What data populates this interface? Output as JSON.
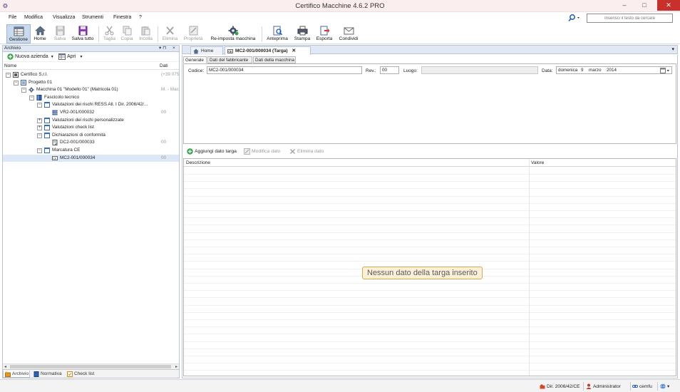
{
  "window": {
    "title": "Certifico Macchine 4.6.2 PRO",
    "minimize": "–",
    "maximize": "□",
    "close": "✕"
  },
  "menu": {
    "items": [
      "File",
      "Modifica",
      "Visualizza",
      "Strumenti",
      "Finestra",
      "?"
    ],
    "search_placeholder": "Inserisci il testo da cercare"
  },
  "toolbar": {
    "buttons": [
      {
        "label": "Gestione",
        "icon": "grid-table-icon",
        "state": "active"
      },
      {
        "label": "Home",
        "icon": "home-icon",
        "state": "enabled"
      },
      {
        "label": "Salva",
        "icon": "save-icon",
        "state": "disabled"
      },
      {
        "label": "Salva tutto",
        "icon": "save-all-icon",
        "state": "enabled"
      },
      {
        "label": "Taglia",
        "icon": "scissors-icon",
        "state": "disabled"
      },
      {
        "label": "Copia",
        "icon": "copy-icon",
        "state": "disabled"
      },
      {
        "label": "Incolla",
        "icon": "paste-icon",
        "state": "disabled"
      },
      {
        "label": "Elimina",
        "icon": "delete-x-icon",
        "state": "disabled"
      },
      {
        "label": "Proprietà",
        "icon": "properties-icon",
        "state": "disabled"
      },
      {
        "label": "Re-imposta macchina",
        "icon": "machine-gear-icon",
        "state": "enabled"
      },
      {
        "label": "Anteprima",
        "icon": "preview-icon",
        "state": "enabled"
      },
      {
        "label": "Stampa",
        "icon": "printer-icon",
        "state": "enabled"
      },
      {
        "label": "Esporta",
        "icon": "export-icon",
        "state": "enabled"
      },
      {
        "label": "Condividi",
        "icon": "mail-icon",
        "state": "enabled"
      }
    ]
  },
  "archive_panel": {
    "title": "Archivio",
    "pin": "▾ ⊓",
    "close": "×",
    "new_company": "Nuova azienda",
    "open": "Apri",
    "col_name": "Nome",
    "col_date": "Dati",
    "tree": [
      {
        "label": "Certifico S.r.l.",
        "date": "(+39 075",
        "level": 0,
        "expander": "−",
        "icon": "company-icon",
        "selected": false
      },
      {
        "label": "Progetto 01",
        "date": "",
        "level": 1,
        "expander": "−",
        "icon": "project-icon",
        "selected": false
      },
      {
        "label": "Macchina 01 \"Modello 01\" (Matricola 01)",
        "date": "M. - Macc",
        "level": 2,
        "expander": "−",
        "icon": "machine-icon",
        "selected": false
      },
      {
        "label": "Fascicolo tecnico",
        "date": "",
        "level": 3,
        "expander": "−",
        "icon": "book-icon",
        "selected": false
      },
      {
        "label": "Valutazioni dei rischi RESS All. I Dir. 2006/42/...",
        "date": "",
        "level": 4,
        "expander": "−",
        "icon": "folder-doc-icon",
        "selected": false
      },
      {
        "label": "VR2-001/000032",
        "date": "00",
        "level": 5,
        "expander": "",
        "icon": "grid-doc-icon",
        "selected": false
      },
      {
        "label": "Valutazioni dei rischi personalizzate",
        "date": "",
        "level": 4,
        "expander": "+",
        "icon": "folder-doc-icon",
        "selected": false
      },
      {
        "label": "Valutazioni check list",
        "date": "",
        "level": 4,
        "expander": "+",
        "icon": "folder-doc-icon",
        "selected": false
      },
      {
        "label": "Dichiarazioni di conformità",
        "date": "",
        "level": 4,
        "expander": "−",
        "icon": "folder-doc-icon",
        "selected": false
      },
      {
        "label": "DC2-001/000033",
        "date": "00",
        "level": 5,
        "expander": "",
        "icon": "declaration-icon",
        "selected": false
      },
      {
        "label": "Marcatura CE",
        "date": "",
        "level": 4,
        "expander": "−",
        "icon": "folder-doc-icon",
        "selected": false
      },
      {
        "label": "MC2-001/000034",
        "date": "00",
        "level": 5,
        "expander": "",
        "icon": "plate-icon",
        "selected": true
      }
    ],
    "bottom_tabs": [
      {
        "label": "Archivio",
        "icon": "archive-icon",
        "active": true
      },
      {
        "label": "Normativa",
        "icon": "law-book-icon",
        "active": false
      },
      {
        "label": "Check list",
        "icon": "checklist-icon",
        "active": false
      }
    ]
  },
  "doc_tabs": {
    "tabs": [
      {
        "label": "Home",
        "icon": "home-icon",
        "active": false
      },
      {
        "label": "MC2-001/000034 (Targa)",
        "icon": "plate-icon",
        "active": true,
        "close": "✕"
      }
    ],
    "menu_arrow": "▾"
  },
  "sub_tabs": [
    "Generale",
    "Dati del fabbricante",
    "Dati della macchina"
  ],
  "form": {
    "codice_label": "Codice:",
    "codice_value": "MC2-001/000034",
    "rev_label": "Rev.:",
    "rev_value": "00",
    "luogo_label": "Luogo:",
    "luogo_value": "",
    "data_label": "Data:",
    "date_weekday": "domenica",
    "date_day": "9",
    "date_month": "marzo",
    "date_year": "2014",
    "calendar_icon": "calendar-dropdown-icon"
  },
  "actions": {
    "add": "Aggiungi dato targa",
    "edit": "Modifica dato",
    "delete": "Elimina dato"
  },
  "grid": {
    "col_description": "Descrizione",
    "col_value": "Valore",
    "empty_message": "Nessun dato della targa inserito"
  },
  "statusbar": {
    "directive": "Dir. 2006/42/CE",
    "user": "Administrator",
    "account": "cemfu",
    "globe": "▾"
  }
}
